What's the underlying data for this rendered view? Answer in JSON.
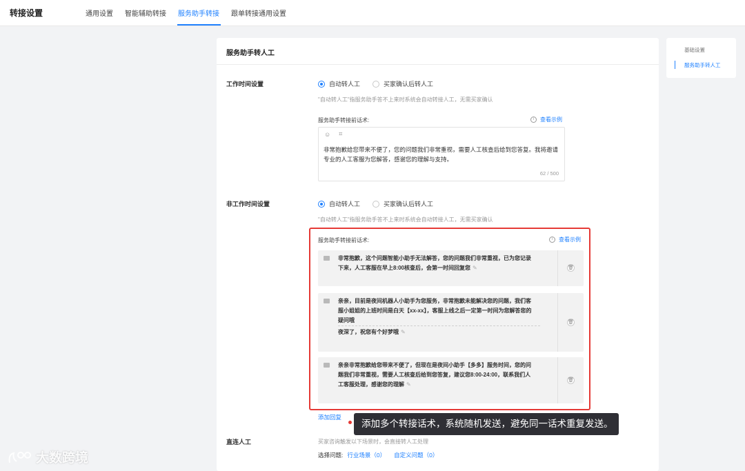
{
  "header": {
    "title": "转接设置",
    "tabs": [
      {
        "label": "通用设置",
        "active": false
      },
      {
        "label": "智能辅助转接",
        "active": false
      },
      {
        "label": "服务助手转接",
        "active": true
      },
      {
        "label": "跟单转接通用设置",
        "active": false
      }
    ],
    "accent_color": "#1e80ff"
  },
  "panel": {
    "title": "服务助手转人工",
    "work_time": {
      "label": "工作时间设置",
      "options": [
        "自动转人工",
        "买家确认后转人工"
      ],
      "selected": "自动转人工",
      "hint": "\"自动转人工\"指服务助手答不上来时系统会自动转接人工，无需买家确认",
      "script_label": "服务助手转接前话术:",
      "example_link": "查看示例",
      "editor_text": "非常抱歉给您带来不便了，您的问题我们非常重视，需要人工核查后给到您答复。我将邀请专业的人工客服为您解答，感谢您的理解与支持。",
      "counter": "62 / 500",
      "tool_icons": [
        "emoji-icon",
        "variable-icon"
      ]
    },
    "off_time": {
      "label": "非工作时间设置",
      "options": [
        "自动转人工",
        "买家确认后转人工"
      ],
      "selected": "自动转人工",
      "hint": "\"自动转人工\"指服务助手答不上来时系统会自动转接人工，无需买家确认",
      "script_label": "服务助手转接前话术:",
      "example_link": "查看示例",
      "replies": [
        {
          "lines": [
            "非常抱歉，这个问题智能小助手无法解答，您的问题我们非常重视，已为您记录下来，人工客服在早上8:00核查后，会第一时间回复您"
          ]
        },
        {
          "lines": [
            "亲亲，目前是夜间机器人小助手为您服务，非常抱歉未能解决您的问题，我们客服小姐姐的上班时间是白天【xx-xx】，客服上线之后一定第一时间为您解答您的疑问哦",
            "夜深了，祝您有个好梦哦"
          ]
        },
        {
          "lines": [
            "亲亲非常抱歉给您带来不便了，但现在是夜间小助手【多多】服务时间，您的问题我们非常重视，需要人工核查后给到您答复，建议您8:00-24:00，联系我们人工客服处理，感谢您的理解"
          ]
        }
      ],
      "add_reply": "添加回复"
    },
    "direct": {
      "label": "直连人工",
      "hint": "买家咨询触发以下场景时，会直接转人工处理",
      "select_label": "选择问题:",
      "industry_link": "行业场景（0）",
      "custom_link": "自定义问题（0）"
    }
  },
  "tooltip": "添加多个转接话术，系统随机发送，避免同一话术重复发送。",
  "anchor_nav": {
    "items": [
      {
        "label": "基础设置",
        "active": false
      },
      {
        "label": "服务助手转人工",
        "active": true
      }
    ]
  },
  "watermark": "大数跨境",
  "colors": {
    "highlight_border": "#e53935",
    "tooltip_bg": "#2f2f35"
  }
}
